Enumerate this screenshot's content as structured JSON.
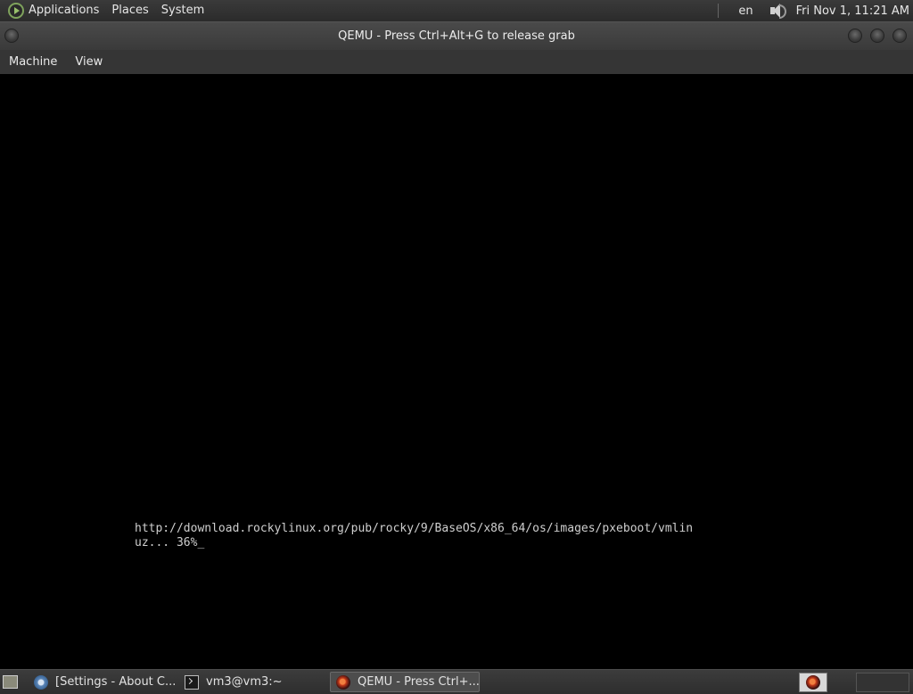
{
  "top_panel": {
    "menus": [
      "Applications",
      "Places",
      "System"
    ],
    "keyboard_layout": "en",
    "clock": "Fri Nov 1, 11:21 AM"
  },
  "window": {
    "title": "QEMU - Press Ctrl+Alt+G to release grab",
    "menu": [
      "Machine",
      "View"
    ]
  },
  "console": {
    "lines": [
      "http://download.rockylinux.org/pub/rocky/9/BaseOS/x86_64/os/images/pxeboot/vmlin",
      "uz... 36%"
    ],
    "cursor": "_",
    "progress_percent": 36
  },
  "taskbar": {
    "tasks": [
      {
        "label": "[Settings - About C...",
        "icon": "settings-icon"
      },
      {
        "label": "vm3@vm3:~",
        "icon": "terminal-icon"
      },
      {
        "label": "QEMU - Press Ctrl+...",
        "icon": "qemu-icon",
        "active": true
      }
    ]
  },
  "colors": {
    "panel": "#2b2b2b",
    "console_text": "#cfcfcf",
    "guest_background": "#000000"
  }
}
